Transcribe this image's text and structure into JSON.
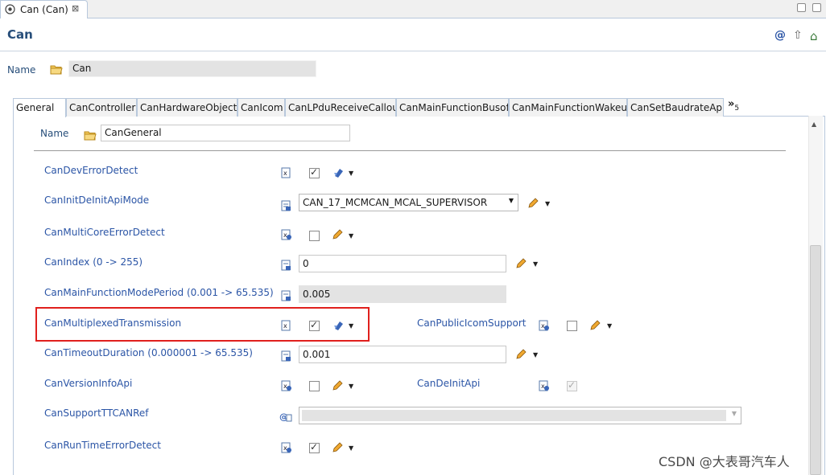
{
  "editor_tab": {
    "label": "Can (Can)",
    "close_glyph": "⊠",
    "icon": "module-icon"
  },
  "header": {
    "title": "Can",
    "icons": [
      "at-icon",
      "up-arrow-icon",
      "home-icon"
    ],
    "icon_glyphs": [
      "@",
      "⇧",
      "⌂"
    ]
  },
  "top_name": {
    "label": "Name",
    "value": "Can"
  },
  "subtabs": [
    {
      "label": "General",
      "active": true
    },
    {
      "label": "CanController"
    },
    {
      "label": "CanHardwareObject"
    },
    {
      "label": "CanIcom"
    },
    {
      "label": "CanLPduReceiveCallou"
    },
    {
      "label": "CanMainFunctionBusof"
    },
    {
      "label": "CanMainFunctionWakeu"
    },
    {
      "label": "CanSetBaudrateApi"
    }
  ],
  "more_tabs": {
    "glyph": "»",
    "count": "5"
  },
  "section_name": {
    "label": "Name",
    "value": "CanGeneral"
  },
  "params": {
    "dev_error_detect": {
      "label": "CanDevErrorDetect",
      "checked": true
    },
    "init_deinit_mode": {
      "label": "CanInitDeInitApiMode",
      "value": "CAN_17_MCMCAN_MCAL_SUPERVISOR"
    },
    "multicore_error_detect": {
      "label": "CanMultiCoreErrorDetect",
      "checked": false
    },
    "can_index": {
      "label": "CanIndex (0 -> 255)",
      "value": "0"
    },
    "main_function_mode_period": {
      "label": "CanMainFunctionModePeriod (0.001 -> 65.535)",
      "value": "0.005"
    },
    "multiplexed_transmission": {
      "label": "CanMultiplexedTransmission",
      "checked": true
    },
    "public_icom_support": {
      "label": "CanPublicIcomSupport",
      "checked": false
    },
    "timeout_duration": {
      "label": "CanTimeoutDuration (0.000001 -> 65.535)",
      "value": "0.001"
    },
    "version_info_api": {
      "label": "CanVersionInfoApi",
      "checked": false
    },
    "deinit_api": {
      "label": "CanDeInitApi",
      "checked": true
    },
    "support_ttcan_ref": {
      "label": "CanSupportTTCANRef",
      "value": ""
    },
    "runtime_error_detect": {
      "label": "CanRunTimeErrorDetect",
      "checked": true
    }
  },
  "watermark": "CSDN @大表哥汽车人",
  "colors": {
    "label_blue": "#2b55a6",
    "title_blue": "#274e7a",
    "highlight_red": "#e0201d"
  }
}
